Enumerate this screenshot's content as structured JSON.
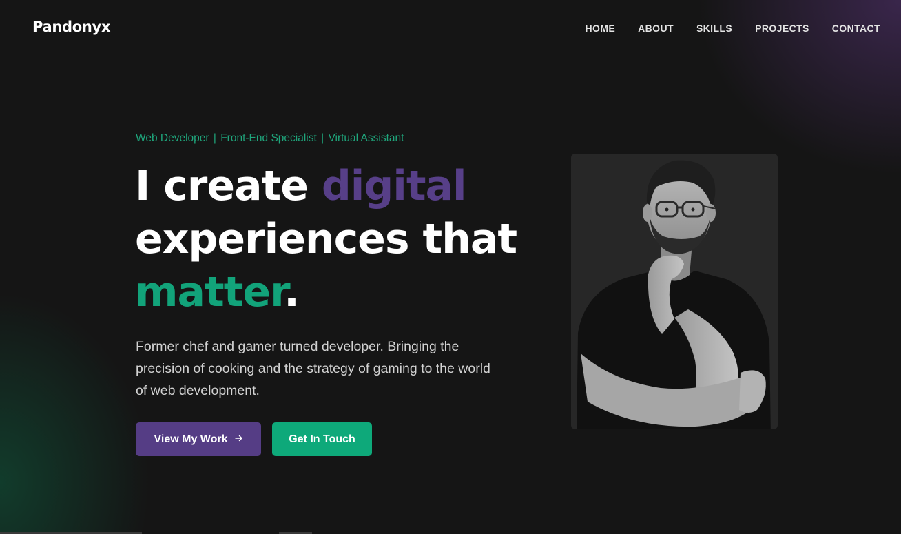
{
  "header": {
    "logo": "Pandonyx",
    "nav": [
      "HOME",
      "ABOUT",
      "SKILLS",
      "PROJECTS",
      "CONTACT"
    ]
  },
  "hero": {
    "tagline": [
      "Web Developer",
      "Front-End Specialist",
      "Virtual Assistant"
    ],
    "headline": {
      "part1": "I create ",
      "highlight1": "digital",
      "part2": "experiences that",
      "highlight2": "matter",
      "period": "."
    },
    "description": "Former chef and gamer turned developer. Bringing the precision of cooking and the strategy of gaming to the world of web development.",
    "primary_button": "View My Work",
    "secondary_button": "Get In Touch"
  },
  "colors": {
    "background": "#151515",
    "accent_purple": "#553d85",
    "accent_green": "#0ea97a"
  },
  "icons": {
    "arrow": "arrow-right-icon"
  }
}
